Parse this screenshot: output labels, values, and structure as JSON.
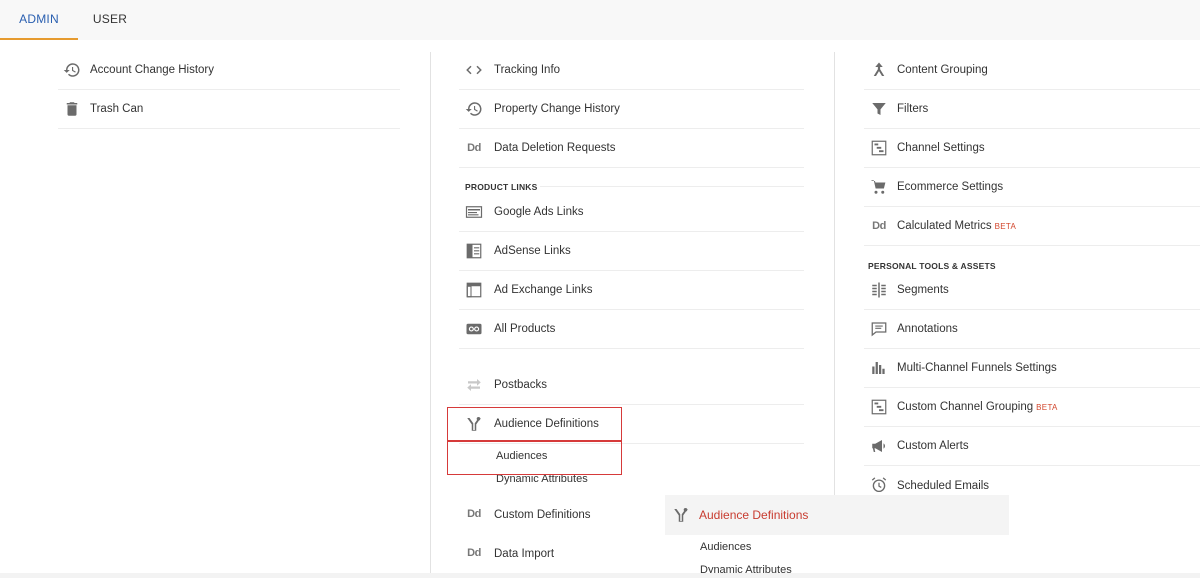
{
  "tabs": {
    "admin": "ADMIN",
    "user": "USER"
  },
  "account_column": {
    "items": [
      {
        "label": "Account Change History",
        "icon": "history-icon"
      },
      {
        "label": "Trash Can",
        "icon": "trash-icon"
      }
    ]
  },
  "property_column": {
    "items": [
      {
        "label": "Tracking Info",
        "icon": "code-icon"
      },
      {
        "label": "Property Change History",
        "icon": "history-icon"
      },
      {
        "label": "Data Deletion Requests",
        "icon": "dd-icon"
      }
    ],
    "product_links_heading": "PRODUCT LINKS",
    "product_links": [
      {
        "label": "Google Ads Links",
        "icon": "ads-icon"
      },
      {
        "label": "AdSense Links",
        "icon": "adsense-icon"
      },
      {
        "label": "Ad Exchange Links",
        "icon": "adexchange-icon"
      },
      {
        "label": "All Products",
        "icon": "all-products-icon"
      }
    ],
    "more": [
      {
        "label": "Postbacks",
        "icon": "postbacks-icon"
      },
      {
        "label": "Audience Definitions",
        "icon": "audience-icon"
      }
    ],
    "audience_sub": [
      "Audiences",
      "Dynamic Attributes"
    ],
    "tail": [
      {
        "label": "Custom Definitions",
        "icon": "dd-icon"
      },
      {
        "label": "Data Import",
        "icon": "dd-icon"
      }
    ],
    "dd_glyph": "Dd"
  },
  "view_column": {
    "items": [
      {
        "label": "Content Grouping",
        "icon": "content-grouping-icon"
      },
      {
        "label": "Filters",
        "icon": "filter-icon"
      },
      {
        "label": "Channel Settings",
        "icon": "channel-icon"
      },
      {
        "label": "Ecommerce Settings",
        "icon": "cart-icon"
      },
      {
        "label": "Calculated Metrics",
        "icon": "dd-icon",
        "badge": "BETA"
      }
    ],
    "personal_heading": "PERSONAL TOOLS & ASSETS",
    "personal": [
      {
        "label": "Segments",
        "icon": "segments-icon"
      },
      {
        "label": "Annotations",
        "icon": "annotation-icon"
      },
      {
        "label": "Multi-Channel Funnels Settings",
        "icon": "bar-chart-icon"
      },
      {
        "label": "Custom Channel Grouping",
        "icon": "channel-icon",
        "badge": "BETA"
      },
      {
        "label": "Custom Alerts",
        "icon": "megaphone-icon"
      },
      {
        "label": "Scheduled Emails",
        "icon": "alarm-icon"
      }
    ]
  },
  "popup": {
    "title": "Audience Definitions",
    "sub": [
      "Audiences",
      "Dynamic Attributes"
    ]
  },
  "colors": {
    "accent_blue": "#2a5fb0",
    "tab_underline": "#e69b2f",
    "highlight_red": "#d63a3a",
    "beta_red": "#d2452b"
  }
}
